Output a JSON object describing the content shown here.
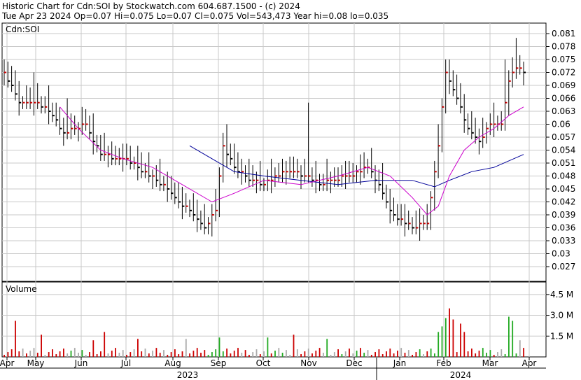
{
  "header": {
    "line1": "Historic Chart for Cdn:SOI by Stockwatch.com 604.687.1500 - (c) 2024",
    "line2": "Tue Apr 23 2024  Op=0.07  Hi=0.075  Lo=0.07  Cl=0.075  Vol=543,473  Year hi=0.08  lo=0.035"
  },
  "chart_data": [
    {
      "type": "ohlc",
      "title": "Cdn:SOI",
      "y_ticks": [
        "0.081",
        "0.078",
        "0.075",
        "0.072",
        "0.069",
        "0.066",
        "0.063",
        "0.06",
        "0.057",
        "0.054",
        "0.051",
        "0.048",
        "0.045",
        "0.042",
        "0.039",
        "0.036",
        "0.033",
        "0.03",
        "0.027"
      ],
      "ylim": [
        0.0245,
        0.0825
      ],
      "grid": true,
      "colors": {
        "close_up": "#cc0000",
        "close_down": "#000000",
        "ma_short": "#cc00cc",
        "ma_long": "#000099",
        "grid": "#c8c8c8"
      },
      "anchors_close": [
        [
          0,
          0.072
        ],
        [
          4,
          0.065
        ],
        [
          9,
          0.065
        ],
        [
          12,
          0.063
        ],
        [
          16,
          0.058
        ],
        [
          22,
          0.06
        ],
        [
          26,
          0.053
        ],
        [
          30,
          0.052
        ],
        [
          33,
          0.052
        ],
        [
          37,
          0.049
        ],
        [
          41,
          0.047
        ],
        [
          44,
          0.045
        ],
        [
          46,
          0.043
        ],
        [
          50,
          0.04
        ],
        [
          54,
          0.036
        ],
        [
          57,
          0.04
        ],
        [
          59,
          0.055
        ],
        [
          62,
          0.05
        ],
        [
          66,
          0.047
        ],
        [
          70,
          0.046
        ],
        [
          73,
          0.048
        ],
        [
          77,
          0.049
        ],
        [
          81,
          0.048
        ],
        [
          85,
          0.046
        ],
        [
          89,
          0.047
        ],
        [
          93,
          0.048
        ],
        [
          98,
          0.05
        ],
        [
          101,
          0.046
        ],
        [
          104,
          0.04
        ],
        [
          106,
          0.038
        ],
        [
          110,
          0.036
        ],
        [
          114,
          0.037
        ],
        [
          117,
          0.055
        ],
        [
          119,
          0.072
        ],
        [
          122,
          0.066
        ],
        [
          125,
          0.059
        ],
        [
          128,
          0.056
        ],
        [
          131,
          0.06
        ],
        [
          134,
          0.06
        ],
        [
          136,
          0.07
        ],
        [
          138,
          0.073
        ],
        [
          140,
          0.072
        ]
      ],
      "spikes": [
        [
          8,
          0.072
        ],
        [
          17,
          0.066
        ],
        [
          60,
          0.06
        ],
        [
          82,
          0.065
        ],
        [
          135,
          0.075
        ],
        [
          138,
          0.08
        ]
      ],
      "ma_short": [
        [
          15,
          0.064
        ],
        [
          20,
          0.059
        ],
        [
          26,
          0.054
        ],
        [
          32,
          0.052
        ],
        [
          40,
          0.05
        ],
        [
          48,
          0.046
        ],
        [
          56,
          0.042
        ],
        [
          62,
          0.044
        ],
        [
          70,
          0.047
        ],
        [
          80,
          0.046
        ],
        [
          90,
          0.048
        ],
        [
          98,
          0.05
        ],
        [
          104,
          0.048
        ],
        [
          110,
          0.043
        ],
        [
          114,
          0.039
        ],
        [
          117,
          0.041
        ],
        [
          120,
          0.048
        ],
        [
          124,
          0.054
        ],
        [
          128,
          0.057
        ],
        [
          132,
          0.059
        ],
        [
          136,
          0.062
        ],
        [
          140,
          0.064
        ]
      ],
      "ma_long": [
        [
          50,
          0.055
        ],
        [
          56,
          0.052
        ],
        [
          62,
          0.049
        ],
        [
          70,
          0.048
        ],
        [
          80,
          0.047
        ],
        [
          90,
          0.046
        ],
        [
          100,
          0.047
        ],
        [
          110,
          0.047
        ],
        [
          116,
          0.0455
        ],
        [
          120,
          0.047
        ],
        [
          126,
          0.049
        ],
        [
          132,
          0.05
        ],
        [
          140,
          0.053
        ]
      ]
    },
    {
      "type": "bar",
      "title": "Volume",
      "y_ticks": [
        "4.5 M",
        "3.0 M",
        "1.5 M"
      ],
      "ylim_millions": [
        0,
        5.4
      ],
      "x_months": [
        "Apr",
        "May",
        "Jun",
        "Jul",
        "Aug",
        "Sep",
        "Oct",
        "Nov",
        "Dec",
        "Jan",
        "Feb",
        "Mar",
        "Apr"
      ],
      "year_labels": [
        "2023",
        "2024"
      ],
      "big_volume_bars": [
        [
          3,
          2.6
        ],
        [
          10,
          1.6
        ],
        [
          24,
          1.2
        ],
        [
          27,
          1.8
        ],
        [
          36,
          1.3
        ],
        [
          49,
          1.3
        ],
        [
          58,
          1.4
        ],
        [
          71,
          1.4
        ],
        [
          78,
          1.6
        ],
        [
          87,
          1.3
        ],
        [
          117,
          1.8
        ],
        [
          118,
          2.2
        ],
        [
          119,
          2.8
        ],
        [
          120,
          3.5
        ],
        [
          121,
          2.7
        ],
        [
          123,
          2.4
        ],
        [
          124,
          1.8
        ],
        [
          136,
          2.9
        ],
        [
          137,
          2.6
        ],
        [
          139,
          1.2
        ]
      ]
    }
  ]
}
